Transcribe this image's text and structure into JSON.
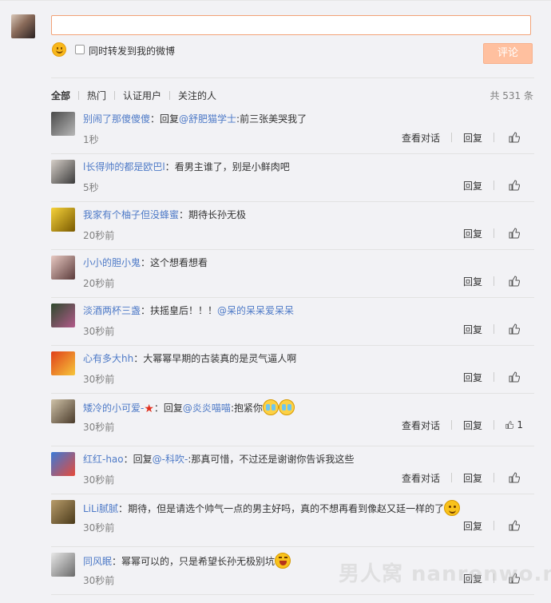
{
  "composer": {
    "input_value": "",
    "repost_label": "同时转发到我的微博",
    "submit_label": "评论"
  },
  "filters": {
    "tabs": [
      "全部",
      "热门",
      "认证用户",
      "关注的人"
    ],
    "total": "共 531 条"
  },
  "labels": {
    "view_conversation": "查看对话",
    "reply": "回复",
    "reply_prefix": "：回复",
    "colon": "："
  },
  "comments": [
    {
      "user": "别闹了那傻傻傻",
      "is_reply": true,
      "at": "@舒肥猫学士",
      "text": ":前三张美哭我了",
      "time": "1秒",
      "has_conversation": true,
      "likes": ""
    },
    {
      "user": "l长得帅的都是欧巴l",
      "is_reply": false,
      "at": "",
      "text": "看男主谁了，别是小鲜肉吧",
      "time": "5秒",
      "has_conversation": false,
      "likes": ""
    },
    {
      "user": "我家有个柚子但没蜂蜜",
      "is_reply": false,
      "at": "",
      "text": "期待长孙无极",
      "time": "20秒前",
      "has_conversation": false,
      "likes": ""
    },
    {
      "user": "小小的胆小鬼",
      "is_reply": false,
      "at": "",
      "text": "这个想看想看",
      "time": "20秒前",
      "has_conversation": false,
      "likes": ""
    },
    {
      "user": "淡酒两杯三盏",
      "is_reply": false,
      "at": "@呆的呆呆爱呆呆",
      "text": "扶摇皇后！！！",
      "time": "30秒前",
      "has_conversation": false,
      "likes": ""
    },
    {
      "user": "心有多大hh",
      "is_reply": false,
      "at": "",
      "text": "大幂幂早期的古装真的是灵气逼人啊",
      "time": "30秒前",
      "has_conversation": false,
      "likes": ""
    },
    {
      "user": "矮冷的小可爱-",
      "is_reply": true,
      "at": "@炎炎喵喵",
      "text": ":抱紧你",
      "time": "30秒前",
      "has_conversation": true,
      "likes": "1"
    },
    {
      "user": "红红-hao",
      "is_reply": true,
      "at": "@-科吹-",
      "text": ":那真可惜，不过还是谢谢你告诉我这些",
      "time": "30秒前",
      "has_conversation": true,
      "likes": ""
    },
    {
      "user": "LiLi腻腻",
      "is_reply": false,
      "at": "",
      "text": "期待，但是请选个帅气一点的男主好吗，真的不想再看到像赵又廷一样的了",
      "time": "30秒前",
      "has_conversation": false,
      "likes": ""
    },
    {
      "user": "同风眠",
      "is_reply": false,
      "at": "",
      "text": "幂幂可以的，只是希望长孙无极别坑",
      "time": "30秒前",
      "has_conversation": false,
      "likes": ""
    }
  ],
  "watermark": "男人窝 nanrenwo.net",
  "colors": {
    "link": "#4e7ac7",
    "accent_border": "#f2a277",
    "button": "#ffc09f"
  },
  "icons": [
    "smile-icon",
    "like-icon",
    "cry-emoji-icon",
    "smile-emoji-icon",
    "laugh-emoji-icon",
    "star-icon"
  ]
}
